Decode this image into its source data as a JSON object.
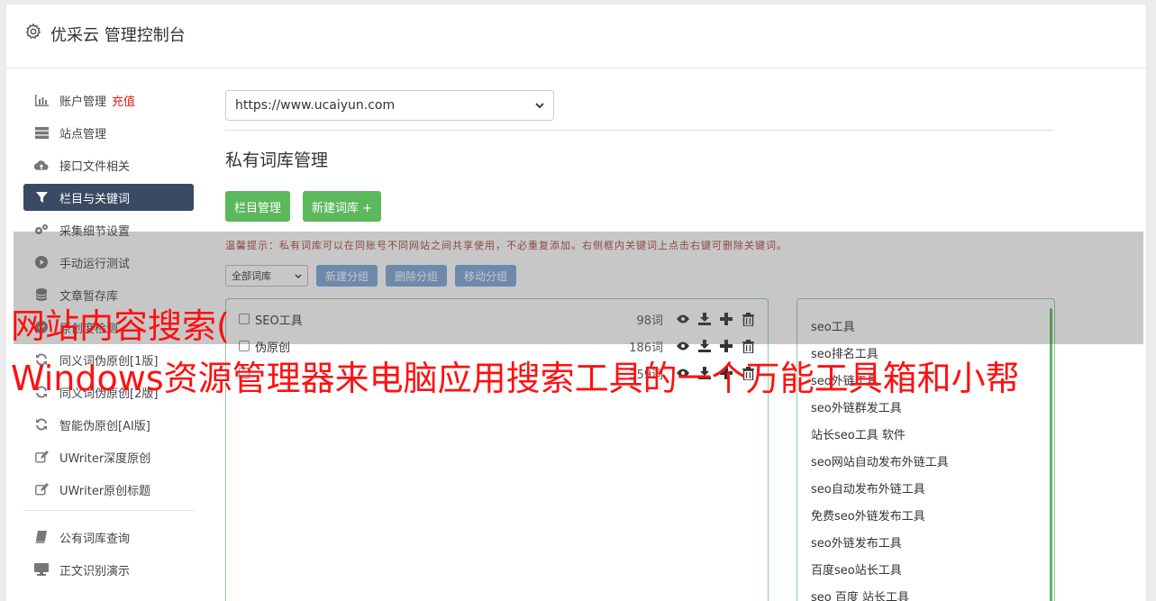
{
  "header": {
    "title": "优采云 管理控制台"
  },
  "sidebar": {
    "items": [
      {
        "label": "账户管理",
        "badge": "充值",
        "icon": "bar-chart-icon"
      },
      {
        "label": "站点管理",
        "icon": "server-icon"
      },
      {
        "label": "接口文件相关",
        "icon": "cloud-upload-icon"
      },
      {
        "label": "栏目与关键词",
        "icon": "filter-icon",
        "active": true
      },
      {
        "label": "采集细节设置",
        "icon": "cogs-icon"
      },
      {
        "label": "手动运行测试",
        "icon": "play-icon"
      },
      {
        "label": "文章暂存库",
        "icon": "database-icon"
      },
      {
        "label": "原创度检测",
        "icon": "check-icon"
      },
      {
        "label": "同义词伪原创[1版]",
        "icon": "refresh-icon"
      },
      {
        "label": "同义词伪原创[2版]",
        "icon": "refresh-icon"
      },
      {
        "label": "智能伪原创[AI版]",
        "icon": "refresh-icon"
      },
      {
        "label": "UWriter深度原创",
        "icon": "edit-icon"
      },
      {
        "label": "UWriter原创标题",
        "icon": "edit-icon"
      }
    ],
    "items2": [
      {
        "label": "公有词库查询",
        "icon": "book-icon"
      },
      {
        "label": "正文识别演示",
        "icon": "monitor-icon"
      }
    ]
  },
  "main": {
    "site_select": "https://www.ucaiyun.com",
    "heading": "私有词库管理",
    "btn_columns": "栏目管理",
    "btn_new_lib": "新建词库 +",
    "tip": "温馨提示：私有词库可以在同账号不同网站之间共享使用，不必重复添加。右侧框内关键词上点击右键可删除关键词。",
    "all_libs": "全部词库",
    "btn_new_group": "新建分组",
    "btn_del_group": "删除分组",
    "btn_move_group": "移动分组"
  },
  "groups": [
    {
      "name": "SEO工具",
      "count": "98词"
    },
    {
      "name": "伪原创",
      "count": "186词"
    },
    {
      "name": "",
      "count": "359词"
    }
  ],
  "keywords": [
    "seo工具",
    "seo排名工具",
    "seo外链工具",
    "seo外链群发工具",
    "站长seo工具 软件",
    "seo网站自动发布外链工具",
    "seo自动发布外链工具",
    "免费seo外链发布工具",
    "seo外链发布工具",
    "百度seo站长工具",
    "seo 百度 站长工具"
  ],
  "banner": {
    "line1": "网站内容搜索(",
    "line2": "Windows资源管理器来电脑应用搜索工具的一个万能工具箱和小帮"
  }
}
